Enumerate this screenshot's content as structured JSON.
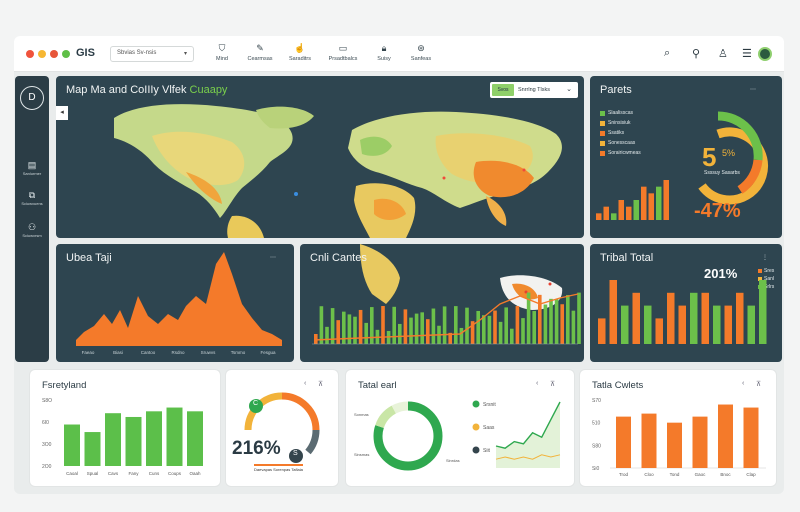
{
  "app": {
    "brand": "GIS",
    "search_placeholder": "Sbvias Sv-nsis"
  },
  "nav": [
    {
      "label": "Mind",
      "icon": "shield-icon"
    },
    {
      "label": "Cearmsas",
      "icon": "pen-icon"
    },
    {
      "label": "Saraditrs",
      "icon": "hand-icon"
    },
    {
      "label": "Prsadtbalcs",
      "icon": "monitor-icon"
    },
    {
      "label": "Suisy",
      "icon": "lock-icon"
    },
    {
      "label": "Sanfeas",
      "icon": "settings-icon"
    }
  ],
  "toolbar": {
    "icons": [
      "search-icon",
      "user-search-icon",
      "person-icon",
      "menu-icon",
      "avatar"
    ]
  },
  "sidebar": {
    "logo": "D",
    "items": [
      {
        "label": "Sanlurmer",
        "icon": "chart-icon"
      },
      {
        "label": "Sciuwxuens",
        "icon": "image-icon"
      },
      {
        "label": "Sciuwxrsm",
        "icon": "users-icon"
      }
    ]
  },
  "map_panel": {
    "title_main": "Map Ma and CoIIIy Vlfek",
    "title_accent": "Cuaapy",
    "dropdown_button": "Svos",
    "dropdown_label": "Snrrlng Tlsks"
  },
  "parcels": {
    "title": "Parets",
    "legend": [
      "Slaalisscas",
      "Sninsisiuk",
      "Ssatiks",
      "Sonesscaas",
      "Sorairicwmeas"
    ],
    "gauge_value": "5",
    "gauge_sub": "5%",
    "gauge_caption": "Ssssuy Sasarbs",
    "change": "-47%",
    "bars": [
      1,
      2,
      1,
      3,
      2,
      3,
      5,
      4,
      5,
      6
    ]
  },
  "urban": {
    "title": "Ubea Taji",
    "x_labels": [
      "Faeao",
      "Biasi",
      "Cantoo",
      "Rsdno",
      "Sruwvs",
      "Tsmmo",
      "Fesgua"
    ]
  },
  "critical": {
    "title": "Cnli Cantes"
  },
  "tribal": {
    "title": "Tribal Total",
    "value": "201%",
    "legend": [
      "Sres",
      "Sanl",
      "Srlrs"
    ],
    "bars": [
      {
        "v": 2,
        "c": "#f47a2a"
      },
      {
        "v": 5,
        "c": "#f47a2a"
      },
      {
        "v": 3,
        "c": "#6cc04a"
      },
      {
        "v": 4,
        "c": "#f47a2a"
      },
      {
        "v": 3,
        "c": "#6cc04a"
      },
      {
        "v": 2,
        "c": "#f47a2a"
      },
      {
        "v": 4,
        "c": "#f47a2a"
      },
      {
        "v": 3,
        "c": "#f47a2a"
      },
      {
        "v": 4,
        "c": "#6cc04a"
      },
      {
        "v": 4,
        "c": "#f47a2a"
      },
      {
        "v": 3,
        "c": "#6cc04a"
      },
      {
        "v": 3,
        "c": "#f47a2a"
      },
      {
        "v": 4,
        "c": "#f47a2a"
      },
      {
        "v": 3,
        "c": "#6cc04a"
      },
      {
        "v": 5,
        "c": "#6cc04a"
      }
    ]
  },
  "family": {
    "title": "Fsretyland",
    "y_ticks": [
      "S8O",
      "6I0",
      "3O0",
      "2O0"
    ],
    "categories": [
      "Caoal",
      "Spual",
      "Cavs",
      "Fany",
      "Cuns",
      "Coups",
      "Oaah"
    ],
    "values": [
      2.2,
      1.8,
      2.8,
      2.6,
      2.9,
      3.1,
      2.9
    ]
  },
  "gauge_card": {
    "value": "216%",
    "badge": "C",
    "badge2": "S",
    "caption": "Daevapas Sorenpas Taflaia"
  },
  "total_card": {
    "title": "Tatal earl",
    "donut_labels": [
      "Sonmas",
      "Sinsmas",
      "Sinrdas"
    ],
    "donut_values": [
      80,
      12,
      8
    ],
    "legend": [
      "Srsnit",
      "Saas",
      "Siit"
    ],
    "line_values": [
      10,
      9,
      12,
      11,
      16,
      14,
      22,
      30
    ],
    "line_values_2": [
      4,
      5,
      4,
      5,
      4,
      6,
      5,
      6
    ]
  },
  "total_owners": {
    "title": "Tatla Cwlets",
    "y_ticks": [
      "S70",
      "510",
      "S80",
      "Si0"
    ],
    "categories": [
      "Trod",
      "Cloo",
      "Tond",
      "Gaoc",
      "Bnoc",
      "Clap"
    ],
    "values": [
      3.4,
      3.6,
      3.0,
      3.4,
      4.2,
      4.0
    ]
  },
  "colors": {
    "panel": "#2e4550",
    "orange": "#f47a2a",
    "green": "#6cc04a",
    "yellow": "#f2b33a"
  }
}
